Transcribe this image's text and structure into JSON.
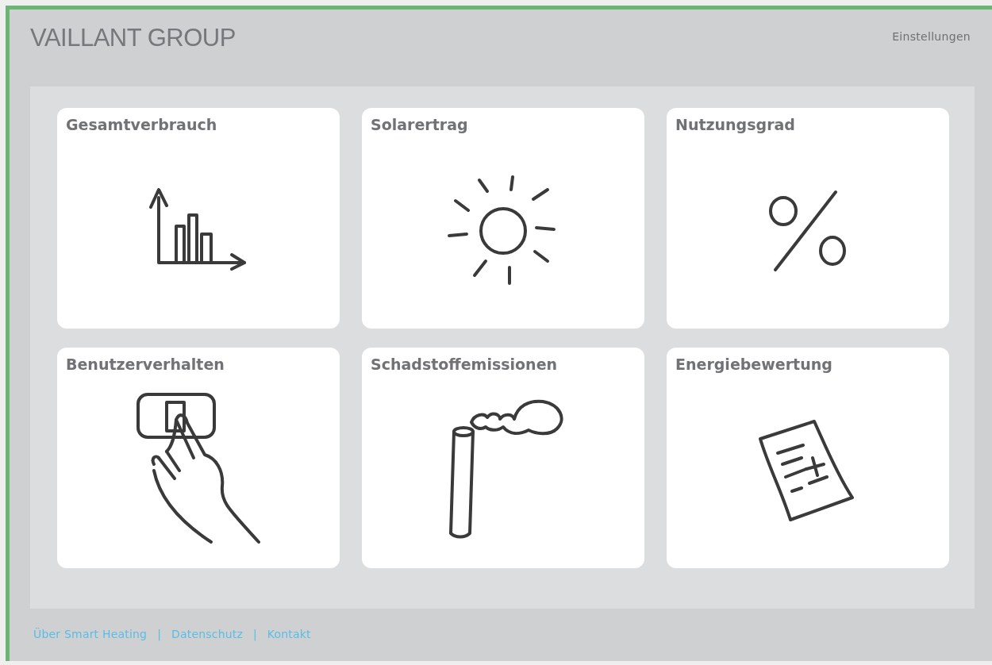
{
  "header": {
    "logo": "VAILLANT GROUP",
    "settings_link": "Einstellungen"
  },
  "tiles": [
    {
      "title": "Gesamtverbrauch",
      "kind": "chart"
    },
    {
      "title": "Solarertrag",
      "kind": "sun"
    },
    {
      "title": "Nutzungsgrad",
      "kind": "percent"
    },
    {
      "title": "Benutzerverhalten",
      "kind": "hand"
    },
    {
      "title": "Schadstoffemissionen",
      "kind": "chimney"
    },
    {
      "title": "Energiebewertung",
      "kind": "document"
    }
  ],
  "footer": {
    "items": [
      {
        "kind": "link",
        "label": "Über Smart Heating"
      },
      {
        "kind": "separator",
        "label": "|"
      },
      {
        "kind": "link",
        "label": "Datenschutz"
      },
      {
        "kind": "separator",
        "label": "|"
      },
      {
        "kind": "link",
        "label": "Kontakt"
      }
    ]
  }
}
